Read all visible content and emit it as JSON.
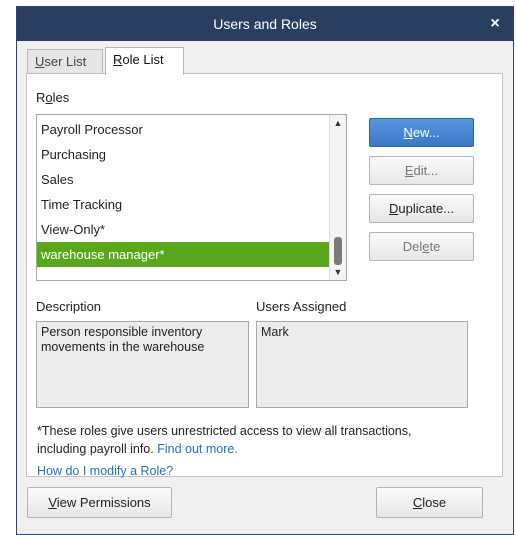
{
  "window": {
    "title": "Users and Roles",
    "close_glyph": "×"
  },
  "tabs": [
    {
      "label": "User List",
      "mnemonic": "U",
      "rest": "ser List",
      "active": false
    },
    {
      "label": "Role List",
      "mnemonic": "R",
      "rest": "ole List",
      "active": true
    }
  ],
  "roles": {
    "label_pre": "R",
    "label_mn": "o",
    "label_post": "les",
    "items": [
      {
        "label": "Payroll Processor",
        "selected": false
      },
      {
        "label": "Purchasing",
        "selected": false
      },
      {
        "label": "Sales",
        "selected": false
      },
      {
        "label": "Time Tracking",
        "selected": false
      },
      {
        "label": "View-Only*",
        "selected": false
      },
      {
        "label": "warehouse manager*",
        "selected": true
      }
    ],
    "scroll_up_icon": "▲",
    "scroll_down_icon": "▼"
  },
  "buttons": {
    "new": {
      "mn": "N",
      "rest": "ew..."
    },
    "edit": {
      "mn": "E",
      "rest": "dit..."
    },
    "duplicate": {
      "mn": "D",
      "rest": "uplicate..."
    },
    "delete": {
      "pre": "Del",
      "mn": "e",
      "post": "te"
    }
  },
  "description": {
    "label": "Description",
    "text": "Person responsible inventory movements in the warehouse"
  },
  "users_assigned": {
    "label": "Users Assigned",
    "text": "Mark"
  },
  "note": {
    "text": "*These roles give users unrestricted access to view all transactions, including payroll info.",
    "link": "Find out more."
  },
  "help_link": "How do I modify a Role?",
  "footer": {
    "view_permissions": {
      "mn": "V",
      "rest": "iew Permissions"
    },
    "close": {
      "mn": "C",
      "rest": "lose"
    }
  },
  "colors": {
    "titlebar": "#2a3e62",
    "selected_row": "#59a81c",
    "primary_button": "#3b77c8",
    "link": "#2b6cc4"
  }
}
